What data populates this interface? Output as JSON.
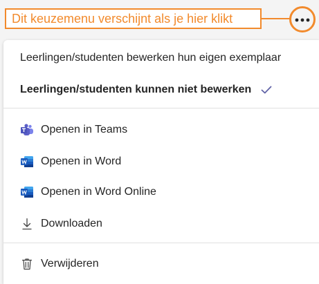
{
  "callout": {
    "text": "Dit keuzemenu verschijnt als je hier klikt",
    "accent_color": "#f28a2c"
  },
  "more_button": {
    "icon": "more-horizontal-icon"
  },
  "menu": {
    "edit_options": [
      {
        "label": "Leerlingen/studenten bewerken hun eigen exemplaar",
        "selected": false
      },
      {
        "label": "Leerlingen/studenten kunnen niet bewerken",
        "selected": true,
        "icon": "checkmark-icon"
      }
    ],
    "open_options": [
      {
        "label": "Openen in Teams",
        "icon": "teams-icon"
      },
      {
        "label": "Openen in Word",
        "icon": "word-icon"
      },
      {
        "label": "Openen in Word Online",
        "icon": "word-icon"
      },
      {
        "label": "Downloaden",
        "icon": "download-icon"
      }
    ],
    "delete_option": {
      "label": "Verwijderen",
      "icon": "trash-icon"
    }
  },
  "colors": {
    "check": "#6264a7",
    "teams": "#5b5fc7",
    "word": "#185abd"
  }
}
